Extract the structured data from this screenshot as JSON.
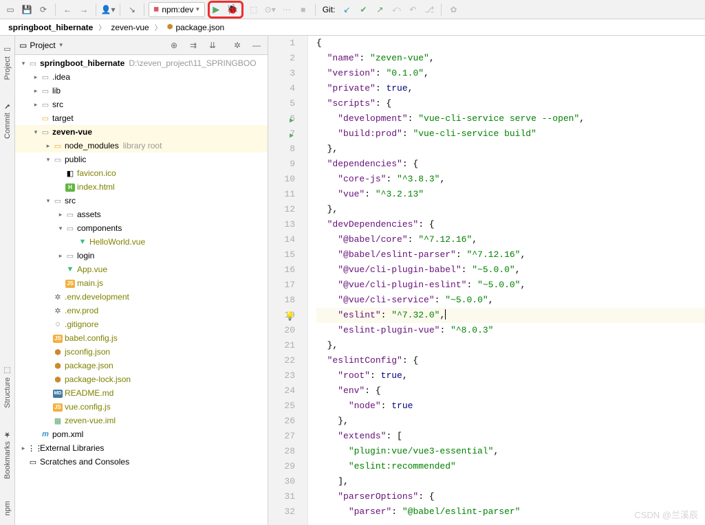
{
  "toolbar": {
    "run_config_label": "npm:dev",
    "git_label": "Git:"
  },
  "breadcrumb": {
    "items": [
      "springboot_hibernate",
      "zeven-vue",
      "package.json"
    ]
  },
  "project_panel": {
    "title": "Project"
  },
  "tree": {
    "root": {
      "label": "springboot_hibernate",
      "hint": "D:\\zeven_project\\11_SPRINGBOO"
    },
    "items": {
      "idea": ".idea",
      "lib": "lib",
      "src": "src",
      "target": "target",
      "zeven_vue": "zeven-vue",
      "node_modules": "node_modules",
      "node_modules_hint": "library root",
      "public": "public",
      "favicon": "favicon.ico",
      "index_html": "index.html",
      "src2": "src",
      "assets": "assets",
      "components": "components",
      "helloworld": "HelloWorld.vue",
      "login": "login",
      "app_vue": "App.vue",
      "main_js": "main.js",
      "env_dev": ".env.development",
      "env_prod": ".env.prod",
      "gitignore": ".gitignore",
      "babel": "babel.config.js",
      "jsconfig": "jsconfig.json",
      "package_json": "package.json",
      "package_lock": "package-lock.json",
      "readme": "README.md",
      "vue_config": "vue.config.js",
      "zeven_iml": "zeven-vue.iml",
      "pom": "pom.xml",
      "ext_lib": "External Libraries",
      "scratches": "Scratches and Consoles"
    }
  },
  "editor": {
    "lines": [
      {
        "n": 1,
        "tokens": [
          [
            "{",
            "punct",
            0
          ]
        ]
      },
      {
        "n": 2,
        "tokens": [
          [
            "\"name\"",
            "key",
            1
          ],
          [
            ": ",
            "punct",
            0
          ],
          [
            "\"zeven-vue\"",
            "str",
            0
          ],
          [
            ",",
            "punct",
            0
          ]
        ]
      },
      {
        "n": 3,
        "tokens": [
          [
            "\"version\"",
            "key",
            1
          ],
          [
            ": ",
            "punct",
            0
          ],
          [
            "\"0.1.0\"",
            "str",
            0
          ],
          [
            ",",
            "punct",
            0
          ]
        ]
      },
      {
        "n": 4,
        "tokens": [
          [
            "\"private\"",
            "key",
            1
          ],
          [
            ": ",
            "punct",
            0
          ],
          [
            "true",
            "kw",
            0
          ],
          [
            ",",
            "punct",
            0
          ]
        ]
      },
      {
        "n": 5,
        "tokens": [
          [
            "\"scripts\"",
            "key",
            1
          ],
          [
            ": {",
            "punct",
            0
          ]
        ]
      },
      {
        "n": 6,
        "run": true,
        "tokens": [
          [
            "\"development\"",
            "key",
            2
          ],
          [
            ": ",
            "punct",
            0
          ],
          [
            "\"vue-cli-service serve --open\"",
            "str",
            0
          ],
          [
            ",",
            "punct",
            0
          ]
        ]
      },
      {
        "n": 7,
        "run": true,
        "tokens": [
          [
            "\"build:prod\"",
            "key",
            2
          ],
          [
            ": ",
            "punct",
            0
          ],
          [
            "\"vue-cli-service build\"",
            "str",
            0
          ]
        ]
      },
      {
        "n": 8,
        "tokens": [
          [
            "},",
            "punct",
            1
          ]
        ]
      },
      {
        "n": 9,
        "tokens": [
          [
            "\"dependencies\"",
            "key",
            1
          ],
          [
            ": {",
            "punct",
            0
          ]
        ]
      },
      {
        "n": 10,
        "tokens": [
          [
            "\"core-js\"",
            "key",
            2
          ],
          [
            ": ",
            "punct",
            0
          ],
          [
            "\"^3.8.3\"",
            "str",
            0
          ],
          [
            ",",
            "punct",
            0
          ]
        ]
      },
      {
        "n": 11,
        "tokens": [
          [
            "\"vue\"",
            "key",
            2
          ],
          [
            ": ",
            "punct",
            0
          ],
          [
            "\"^3.2.13\"",
            "str",
            0
          ]
        ]
      },
      {
        "n": 12,
        "tokens": [
          [
            "},",
            "punct",
            1
          ]
        ]
      },
      {
        "n": 13,
        "tokens": [
          [
            "\"devDependencies\"",
            "key",
            1
          ],
          [
            ": {",
            "punct",
            0
          ]
        ]
      },
      {
        "n": 14,
        "tokens": [
          [
            "\"@babel/core\"",
            "key",
            2
          ],
          [
            ": ",
            "punct",
            0
          ],
          [
            "\"^7.12.16\"",
            "str",
            0
          ],
          [
            ",",
            "punct",
            0
          ]
        ]
      },
      {
        "n": 15,
        "tokens": [
          [
            "\"@babel/eslint-parser\"",
            "key",
            2
          ],
          [
            ": ",
            "punct",
            0
          ],
          [
            "\"^7.12.16\"",
            "str",
            0
          ],
          [
            ",",
            "punct",
            0
          ]
        ]
      },
      {
        "n": 16,
        "tokens": [
          [
            "\"@vue/cli-plugin-babel\"",
            "key",
            2
          ],
          [
            ": ",
            "punct",
            0
          ],
          [
            "\"~5.0.0\"",
            "str",
            0
          ],
          [
            ",",
            "punct",
            0
          ]
        ]
      },
      {
        "n": 17,
        "tokens": [
          [
            "\"@vue/cli-plugin-eslint\"",
            "key",
            2
          ],
          [
            ": ",
            "punct",
            0
          ],
          [
            "\"~5.0.0\"",
            "str",
            0
          ],
          [
            ",",
            "punct",
            0
          ]
        ]
      },
      {
        "n": 18,
        "tokens": [
          [
            "\"@vue/cli-service\"",
            "key",
            2
          ],
          [
            ": ",
            "punct",
            0
          ],
          [
            "\"~5.0.0\"",
            "str",
            0
          ],
          [
            ",",
            "punct",
            0
          ]
        ]
      },
      {
        "n": 19,
        "bulb": true,
        "current": true,
        "tokens": [
          [
            "\"eslint\"",
            "key",
            2
          ],
          [
            ": ",
            "punct",
            0
          ],
          [
            "\"^7.32.0\"",
            "str",
            0
          ],
          [
            ",",
            "punct",
            0
          ]
        ],
        "caret": true
      },
      {
        "n": 20,
        "tokens": [
          [
            "\"eslint-plugin-vue\"",
            "key",
            2
          ],
          [
            ": ",
            "punct",
            0
          ],
          [
            "\"^8.0.3\"",
            "str",
            0
          ]
        ]
      },
      {
        "n": 21,
        "tokens": [
          [
            "},",
            "punct",
            1
          ]
        ]
      },
      {
        "n": 22,
        "tokens": [
          [
            "\"eslintConfig\"",
            "key",
            1
          ],
          [
            ": {",
            "punct",
            0
          ]
        ]
      },
      {
        "n": 23,
        "tokens": [
          [
            "\"root\"",
            "key",
            2
          ],
          [
            ": ",
            "punct",
            0
          ],
          [
            "true",
            "kw",
            0
          ],
          [
            ",",
            "punct",
            0
          ]
        ]
      },
      {
        "n": 24,
        "tokens": [
          [
            "\"env\"",
            "key",
            2
          ],
          [
            ": {",
            "punct",
            0
          ]
        ]
      },
      {
        "n": 25,
        "tokens": [
          [
            "\"node\"",
            "key",
            3
          ],
          [
            ": ",
            "punct",
            0
          ],
          [
            "true",
            "kw",
            0
          ]
        ]
      },
      {
        "n": 26,
        "tokens": [
          [
            "},",
            "punct",
            2
          ]
        ]
      },
      {
        "n": 27,
        "tokens": [
          [
            "\"extends\"",
            "key",
            2
          ],
          [
            ": [",
            "punct",
            0
          ]
        ]
      },
      {
        "n": 28,
        "tokens": [
          [
            "\"plugin:vue/vue3-essential\"",
            "str",
            3
          ],
          [
            ",",
            "punct",
            0
          ]
        ]
      },
      {
        "n": 29,
        "tokens": [
          [
            "\"eslint:recommended\"",
            "str",
            3
          ]
        ]
      },
      {
        "n": 30,
        "tokens": [
          [
            "],",
            "punct",
            2
          ]
        ]
      },
      {
        "n": 31,
        "tokens": [
          [
            "\"parserOptions\"",
            "key",
            2
          ],
          [
            ": {",
            "punct",
            0
          ]
        ]
      },
      {
        "n": 32,
        "tokens": [
          [
            "\"parser\"",
            "key",
            3
          ],
          [
            ": ",
            "punct",
            0
          ],
          [
            "\"@babel/eslint-parser\"",
            "str",
            0
          ]
        ]
      }
    ]
  },
  "left_rail": {
    "project": "Project",
    "commit": "Commit",
    "structure": "Structure",
    "bookmarks": "Bookmarks",
    "npm": "npm"
  },
  "watermark": "CSDN @兰溪辰"
}
